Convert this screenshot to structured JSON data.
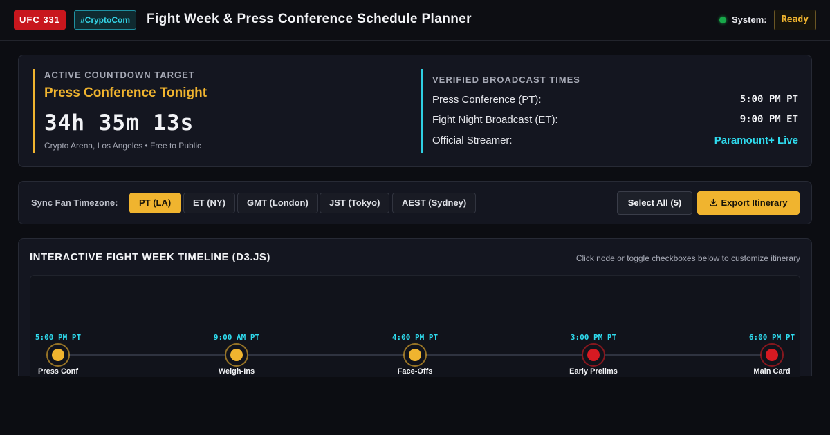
{
  "header": {
    "event_badge": "UFC 331",
    "hashtag_badge": "#CryptoCom",
    "title": "Fight Week & Press Conference Schedule Planner",
    "status_label": "System:",
    "status_value": "Ready",
    "status_color": "#18a84a"
  },
  "countdown": {
    "label": "ACTIVE COUNTDOWN TARGET",
    "event": "Press Conference Tonight",
    "timer": "34h 35m 13s",
    "venue": "Crypto Arena, Los Angeles • Free to Public"
  },
  "broadcast": {
    "label": "VERIFIED BROADCAST TIMES",
    "rows": [
      {
        "key": "Press Conference (PT):",
        "value": "5:00 PM PT"
      },
      {
        "key": "Fight Night Broadcast (ET):",
        "value": "9:00 PM ET"
      },
      {
        "key": "Official Streamer:",
        "value": "Paramount+ Live"
      }
    ]
  },
  "timezone": {
    "label": "Sync Fan Timezone:",
    "options": [
      "PT (LA)",
      "ET (NY)",
      "GMT (London)",
      "JST (Tokyo)",
      "AEST (Sydney)"
    ],
    "selected": "PT (LA)",
    "select_all_label": "Select All (5)",
    "export_label": "Export Itinerary"
  },
  "timeline": {
    "title": "INTERACTIVE FIGHT WEEK TIMELINE (D3.JS)",
    "hint": "Click node or toggle checkboxes below to customize itinerary",
    "events": [
      {
        "label": "Press Conf",
        "time": "5:00 PM PT",
        "kind": "media"
      },
      {
        "label": "Weigh-Ins",
        "time": "9:00 AM PT",
        "kind": "media"
      },
      {
        "label": "Face-Offs",
        "time": "4:00 PM PT",
        "kind": "media"
      },
      {
        "label": "Early Prelims",
        "time": "3:00 PM PT",
        "kind": "fight"
      },
      {
        "label": "Main Card",
        "time": "6:00 PM PT",
        "kind": "fight"
      }
    ]
  },
  "colors": {
    "accent_gold": "#f0b42f",
    "accent_cyan": "#2fdcef",
    "fight_red": "#d61a22",
    "brand_red": "#c8161d"
  }
}
